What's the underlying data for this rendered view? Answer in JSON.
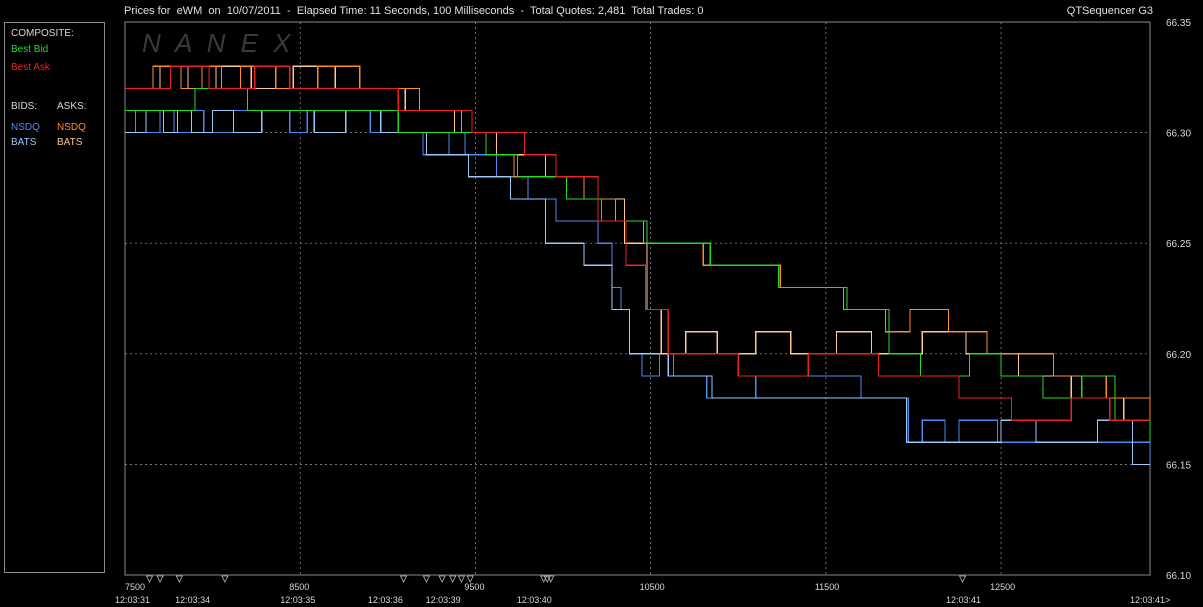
{
  "header": {
    "title": "Prices for  eWM  on  10/07/2011  -  Elapsed Time: 11 Seconds, 100 Milliseconds  -  Total Quotes: 2,481  Total Trades: 0",
    "brand": "QTSequencer G3"
  },
  "watermark": "N A N E X",
  "legend": {
    "composite_label": "COMPOSITE:",
    "best_bid": "Best Bid",
    "best_ask": "Best Ask",
    "bids_label": "BIDS:",
    "asks_label": "ASKS:",
    "bid_nsdq": "NSDQ",
    "bid_bats": "BATS",
    "ask_nsdq": "NSDQ",
    "ask_bats": "BATS"
  },
  "colors": {
    "best_bid": "#22dd22",
    "best_ask": "#ee2222",
    "bid_nsdq": "#4a8cf0",
    "bid_bats": "#9cc8f8",
    "ask_nsdq": "#ff8a2a",
    "ask_bats": "#ffc890",
    "grid": "#9a9a9a",
    "frame": "#8a8a8a"
  },
  "chart_data": {
    "type": "line",
    "xlim": [
      7500,
      13350
    ],
    "ylim": [
      66.1,
      66.35
    ],
    "y_ticks": [
      "66.35",
      "66.30",
      "66.25",
      "66.20",
      "66.15",
      "66.10"
    ],
    "x_ticks": [
      "7500",
      "8500",
      "9500",
      "10500",
      "11500",
      "12500"
    ],
    "x_ticks_vals": [
      7500,
      8500,
      9500,
      10500,
      11500,
      12500
    ],
    "time_labels": [
      {
        "x": 7500,
        "t": "12:03:31"
      },
      {
        "x": 7900,
        "t": "12:03:34"
      },
      {
        "x": 8500,
        "t": "12:03:35"
      },
      {
        "x": 9000,
        "t": "12:03:36"
      },
      {
        "x": 9330,
        "t": "12:03:39"
      },
      {
        "x": 9850,
        "t": "12:03:40"
      },
      {
        "x": 12300,
        "t": "12:03:41"
      },
      {
        "x": 13350,
        "t": "12:03:41>"
      }
    ],
    "markers_x": [
      7640,
      7700,
      7810,
      8070,
      9090,
      9220,
      9310,
      9370,
      9420,
      9470,
      9890,
      9910,
      9930,
      12280
    ],
    "grid": true,
    "series": [
      {
        "name": "NSDQ",
        "role": "bid",
        "color": "#4a8cf0",
        "points": [
          [
            7500,
            66.31
          ],
          [
            7560,
            66.3
          ],
          [
            7700,
            66.31
          ],
          [
            7780,
            66.3
          ],
          [
            7880,
            66.31
          ],
          [
            7950,
            66.3
          ],
          [
            8120,
            66.31
          ],
          [
            8440,
            66.3
          ],
          [
            8540,
            66.31
          ],
          [
            8900,
            66.3
          ],
          [
            9200,
            66.29
          ],
          [
            9350,
            66.3
          ],
          [
            9440,
            66.29
          ],
          [
            9620,
            66.28
          ],
          [
            9800,
            66.27
          ],
          [
            9960,
            66.26
          ],
          [
            10200,
            66.25
          ],
          [
            10280,
            66.23
          ],
          [
            10330,
            66.22
          ],
          [
            10380,
            66.2
          ],
          [
            10450,
            66.19
          ],
          [
            10550,
            66.2
          ],
          [
            10630,
            66.19
          ],
          [
            10820,
            66.18
          ],
          [
            11100,
            66.19
          ],
          [
            11700,
            66.18
          ],
          [
            11970,
            66.16
          ],
          [
            12050,
            66.17
          ],
          [
            12180,
            66.16
          ],
          [
            12260,
            66.17
          ],
          [
            12480,
            66.16
          ],
          [
            13350,
            66.15
          ]
        ]
      },
      {
        "name": "BATS",
        "role": "bid",
        "color": "#9cc8f8",
        "points": [
          [
            7500,
            66.3
          ],
          [
            7620,
            66.31
          ],
          [
            7720,
            66.3
          ],
          [
            7800,
            66.31
          ],
          [
            7880,
            66.3
          ],
          [
            8000,
            66.31
          ],
          [
            8120,
            66.3
          ],
          [
            8280,
            66.31
          ],
          [
            8580,
            66.3
          ],
          [
            8760,
            66.31
          ],
          [
            8960,
            66.3
          ],
          [
            9220,
            66.29
          ],
          [
            9460,
            66.28
          ],
          [
            9700,
            66.27
          ],
          [
            9900,
            66.25
          ],
          [
            10120,
            66.24
          ],
          [
            10280,
            66.22
          ],
          [
            10380,
            66.2
          ],
          [
            10600,
            66.19
          ],
          [
            10850,
            66.18
          ],
          [
            11700,
            66.18
          ],
          [
            11960,
            66.16
          ],
          [
            12500,
            66.17
          ],
          [
            12700,
            66.16
          ],
          [
            13050,
            66.17
          ],
          [
            13250,
            66.15
          ]
        ]
      },
      {
        "name": "NSDQ",
        "role": "ask",
        "color": "#ff8a2a",
        "points": [
          [
            7500,
            66.32
          ],
          [
            7660,
            66.33
          ],
          [
            7820,
            66.32
          ],
          [
            7940,
            66.33
          ],
          [
            8050,
            66.32
          ],
          [
            8160,
            66.33
          ],
          [
            8360,
            66.32
          ],
          [
            8600,
            66.33
          ],
          [
            8840,
            66.32
          ],
          [
            9180,
            66.31
          ],
          [
            9420,
            66.3
          ],
          [
            9560,
            66.29
          ],
          [
            9720,
            66.28
          ],
          [
            9980,
            66.28
          ],
          [
            10120,
            66.27
          ],
          [
            10300,
            66.26
          ],
          [
            10460,
            66.25
          ],
          [
            10800,
            66.24
          ],
          [
            11240,
            66.23
          ],
          [
            11600,
            66.22
          ],
          [
            11840,
            66.21
          ],
          [
            11980,
            66.22
          ],
          [
            12200,
            66.21
          ],
          [
            12420,
            66.2
          ],
          [
            12800,
            66.19
          ],
          [
            13100,
            66.18
          ],
          [
            13350,
            66.17
          ]
        ]
      },
      {
        "name": "BATS",
        "role": "ask",
        "color": "#ffc890",
        "points": [
          [
            7500,
            66.32
          ],
          [
            7700,
            66.33
          ],
          [
            7860,
            66.32
          ],
          [
            8020,
            66.33
          ],
          [
            8220,
            66.32
          ],
          [
            8460,
            66.33
          ],
          [
            8700,
            66.32
          ],
          [
            9100,
            66.31
          ],
          [
            9380,
            66.3
          ],
          [
            9620,
            66.29
          ],
          [
            9900,
            66.28
          ],
          [
            10200,
            66.27
          ],
          [
            10350,
            66.25
          ],
          [
            10480,
            66.22
          ],
          [
            10560,
            66.2
          ],
          [
            10700,
            66.21
          ],
          [
            10880,
            66.2
          ],
          [
            11100,
            66.21
          ],
          [
            11300,
            66.2
          ],
          [
            11560,
            66.21
          ],
          [
            11760,
            66.2
          ],
          [
            12050,
            66.21
          ],
          [
            12300,
            66.2
          ],
          [
            12600,
            66.19
          ],
          [
            12900,
            66.18
          ],
          [
            13200,
            66.17
          ],
          [
            13350,
            66.17
          ]
        ]
      },
      {
        "name": "Best Bid",
        "role": "best",
        "color": "#22dd22",
        "points": [
          [
            7500,
            66.31
          ],
          [
            7900,
            66.32
          ],
          [
            8200,
            66.31
          ],
          [
            8700,
            66.31
          ],
          [
            9060,
            66.3
          ],
          [
            9400,
            66.3
          ],
          [
            9560,
            66.29
          ],
          [
            9740,
            66.28
          ],
          [
            10020,
            66.27
          ],
          [
            10220,
            66.26
          ],
          [
            10480,
            66.25
          ],
          [
            10840,
            66.24
          ],
          [
            11230,
            66.23
          ],
          [
            11620,
            66.22
          ],
          [
            11860,
            66.2
          ],
          [
            12040,
            66.19
          ],
          [
            12320,
            66.2
          ],
          [
            12500,
            66.19
          ],
          [
            12740,
            66.18
          ],
          [
            12960,
            66.19
          ],
          [
            13150,
            66.17
          ],
          [
            13350,
            66.16
          ]
        ]
      },
      {
        "name": "Best Ask",
        "role": "best",
        "color": "#ee2222",
        "points": [
          [
            7500,
            66.32
          ],
          [
            7760,
            66.33
          ],
          [
            7980,
            66.32
          ],
          [
            8240,
            66.33
          ],
          [
            8440,
            66.32
          ],
          [
            8780,
            66.32
          ],
          [
            9060,
            66.31
          ],
          [
            9480,
            66.3
          ],
          [
            9780,
            66.29
          ],
          [
            9960,
            66.28
          ],
          [
            10200,
            66.26
          ],
          [
            10360,
            66.24
          ],
          [
            10470,
            66.22
          ],
          [
            10600,
            66.2
          ],
          [
            11000,
            66.19
          ],
          [
            11400,
            66.2
          ],
          [
            11800,
            66.19
          ],
          [
            12260,
            66.18
          ],
          [
            12560,
            66.17
          ],
          [
            12900,
            66.18
          ],
          [
            13120,
            66.17
          ],
          [
            13350,
            66.17
          ]
        ]
      }
    ]
  }
}
